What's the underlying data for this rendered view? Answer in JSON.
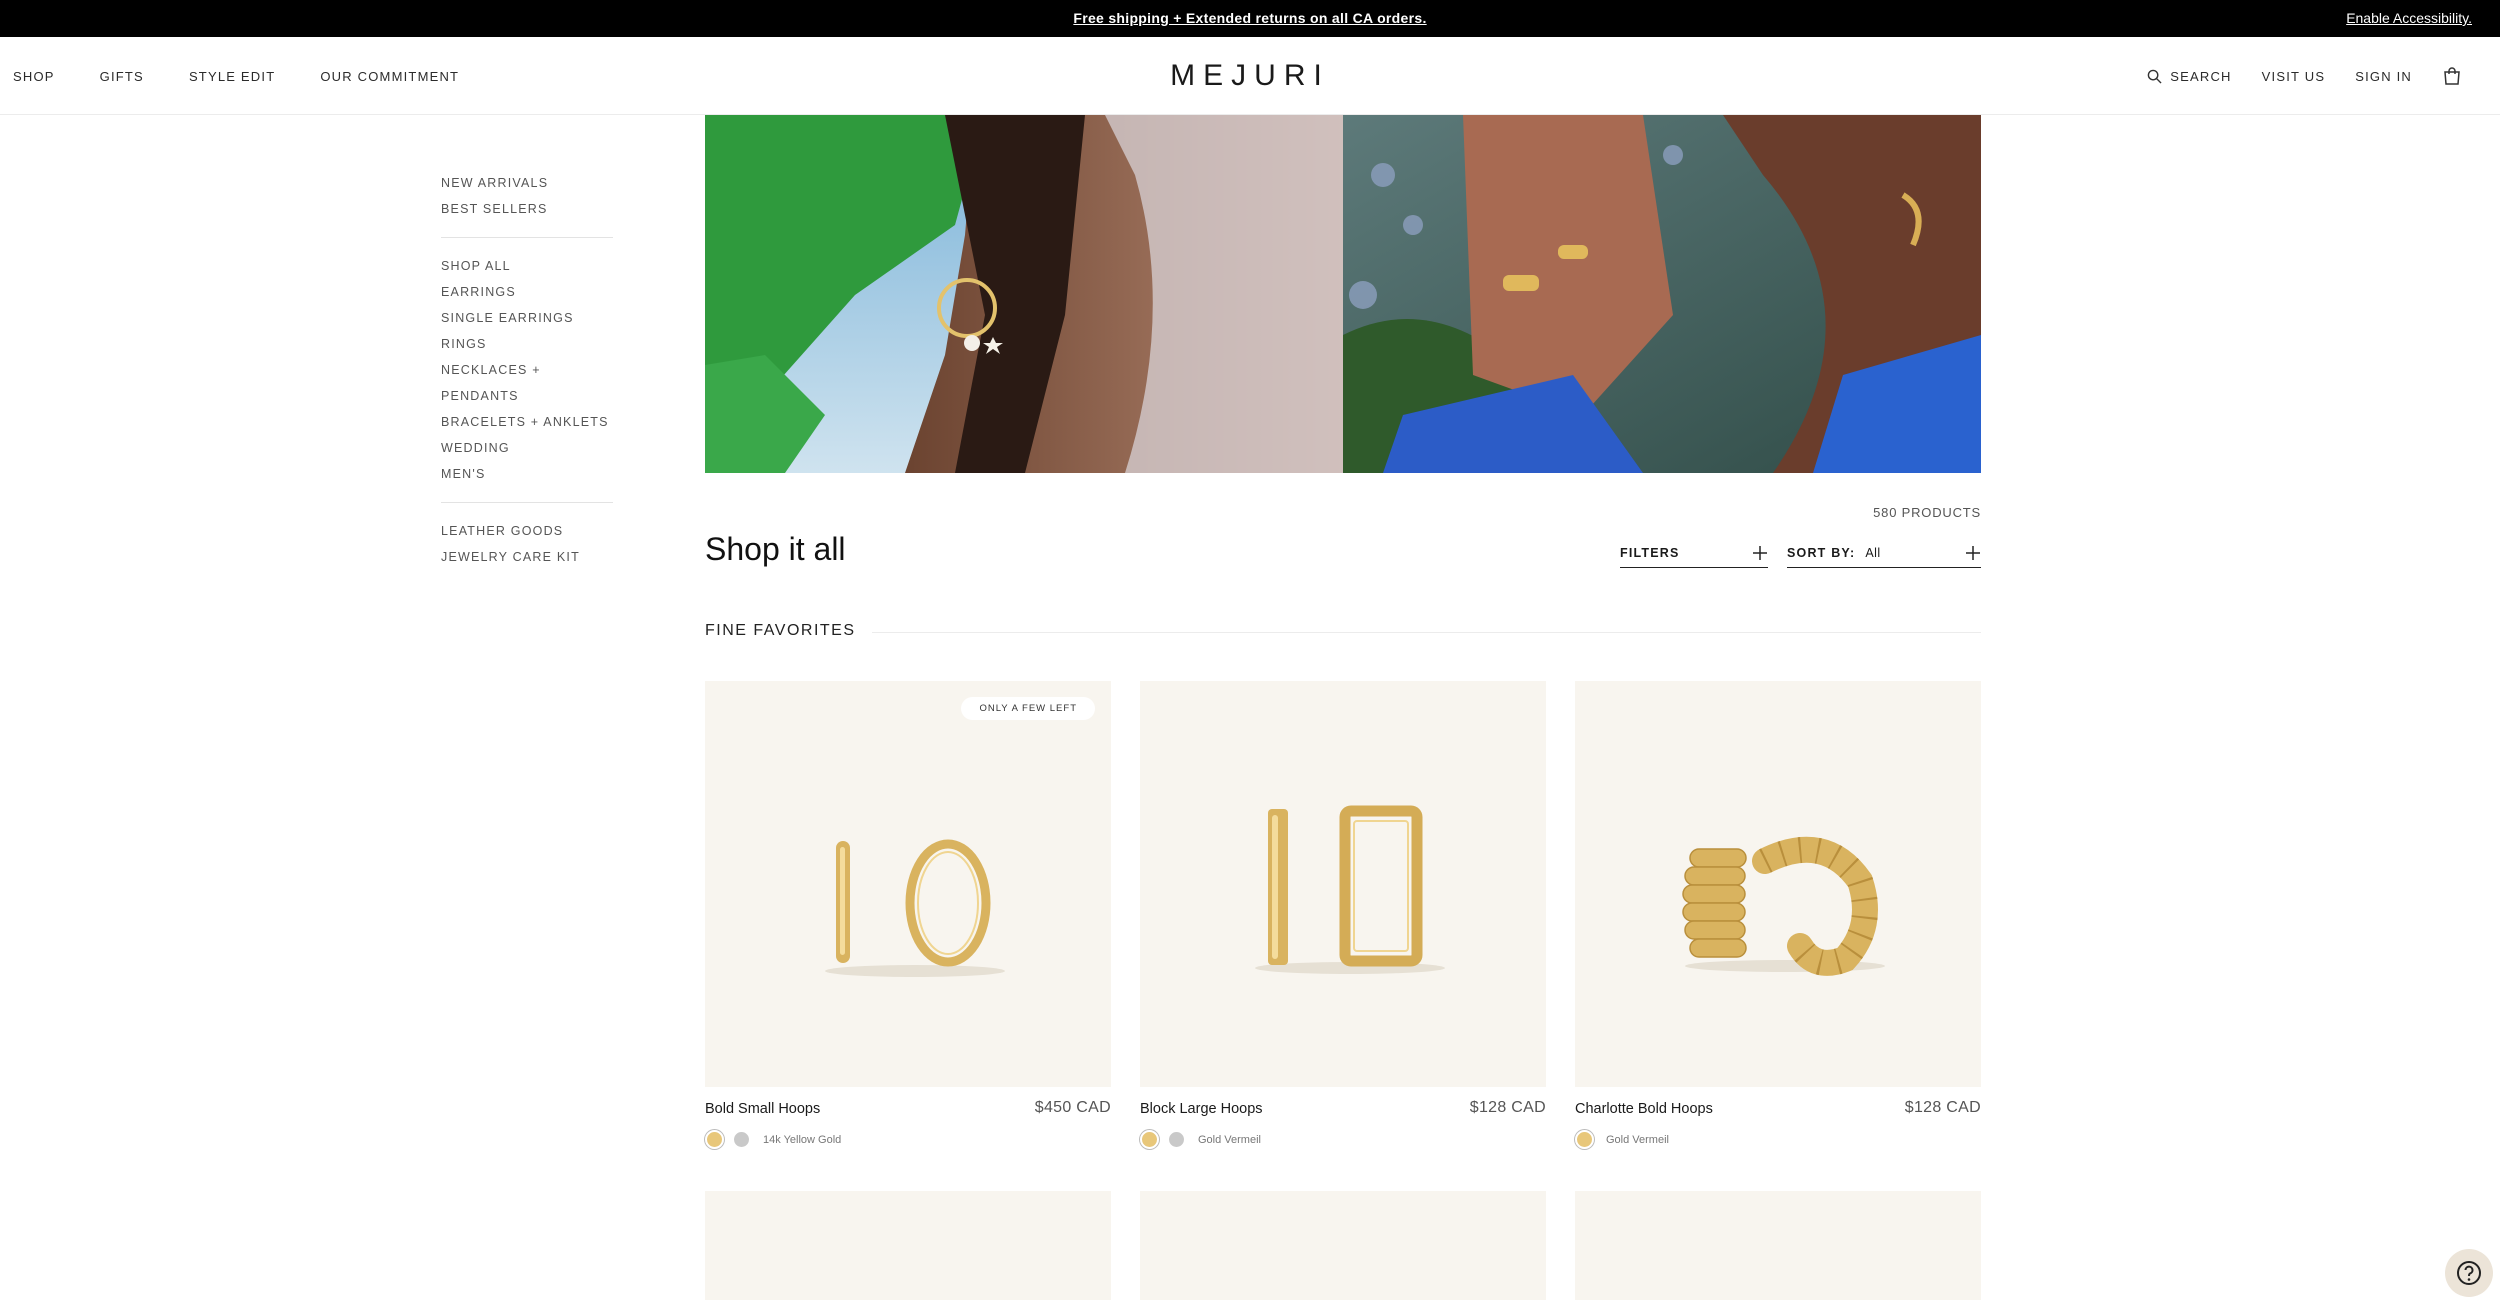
{
  "announcement": {
    "promo_text": "Free shipping + Extended returns on all CA orders.",
    "accessibility_text": "Enable Accessibility."
  },
  "header": {
    "logo": "MEJURI",
    "nav_left": [
      "SHOP",
      "GIFTS",
      "STYLE EDIT",
      "OUR COMMITMENT"
    ],
    "search_label": "SEARCH",
    "visit_label": "VISIT US",
    "signin_label": "SIGN IN",
    "bag_icon": "bag-icon"
  },
  "sidebar": {
    "group1": [
      "NEW ARRIVALS",
      "BEST SELLERS"
    ],
    "group2": [
      "SHOP ALL",
      "EARRINGS",
      "SINGLE EARRINGS",
      "RINGS",
      "NECKLACES + PENDANTS",
      "BRACELETS + ANKLETS",
      "WEDDING",
      "MEN'S"
    ],
    "group3": [
      "LEATHER GOODS",
      "JEWELRY CARE KIT"
    ]
  },
  "listing": {
    "count": "580 PRODUCTS",
    "title": "Shop it all",
    "filters_label": "FILTERS",
    "sort_label": "SORT BY:",
    "sort_value": "All",
    "section_title": "FINE FAVORITES"
  },
  "products": [
    {
      "name": "Bold Small Hoops",
      "price": "$450 CAD",
      "badge": "ONLY A FEW LEFT",
      "swatches": [
        "#e8c77a",
        "#c9c9c9"
      ],
      "swatch_label": "14k Yellow Gold"
    },
    {
      "name": "Block Large Hoops",
      "price": "$128 CAD",
      "badge": "",
      "swatches": [
        "#e8c77a",
        "#c9c9c9"
      ],
      "swatch_label": "Gold Vermeil"
    },
    {
      "name": "Charlotte Bold Hoops",
      "price": "$128 CAD",
      "badge": "",
      "swatches": [
        "#e8c77a"
      ],
      "swatch_label": "Gold Vermeil"
    }
  ],
  "colors": {
    "announcement_bg": "#000000",
    "product_bg": "#f8f5ef",
    "gold": "#e8c77a",
    "help_bg": "#ece4d8"
  }
}
